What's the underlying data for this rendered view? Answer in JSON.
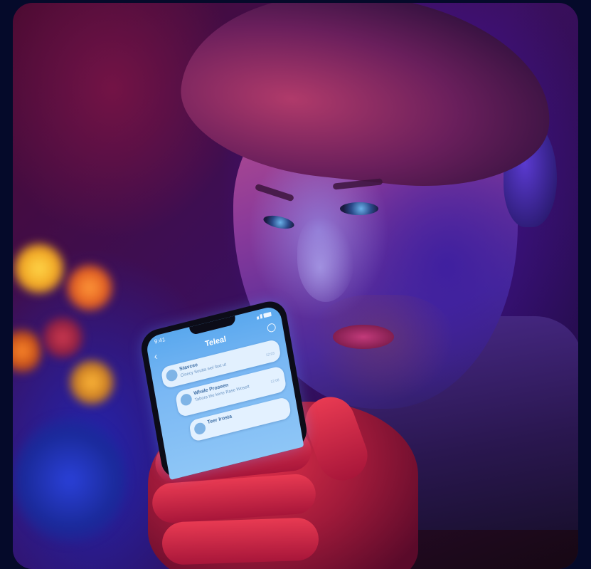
{
  "scene": {
    "description_tag": "person-looking-at-phone",
    "colors": {
      "border": "#050a2a",
      "ambient_magenta": "#6a1f5c",
      "ambient_blue": "#2a2ab0",
      "screen_blue": "#5aa8ee"
    }
  },
  "phone": {
    "status_time": "9:41",
    "title": "Teleal",
    "back_icon": "chevron-left-icon",
    "profile_icon": "settings-icon",
    "cards": [
      {
        "title": "Stavcee",
        "text": "Cinecy Soutta wel faxt ut",
        "meta": "12:03"
      },
      {
        "title": "Whale Proseen",
        "text": "Tabora the kene Rase Wosett",
        "meta": "12:08"
      },
      {
        "title": "Teer Irosta",
        "text": "",
        "meta": ""
      }
    ]
  }
}
